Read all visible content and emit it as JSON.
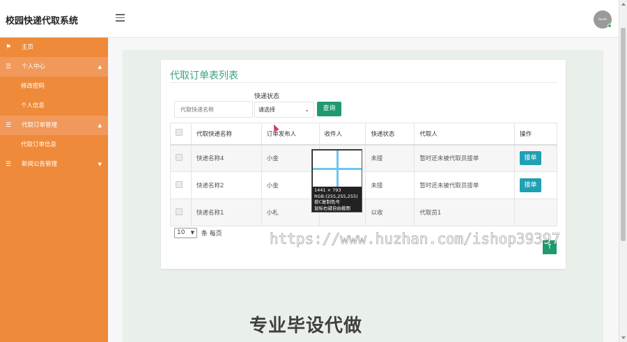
{
  "app": {
    "title": "校园快递代取系统",
    "avatar_text": "Goods",
    "accent_color": "#ee8a3a",
    "primary_color": "#1e9a6e"
  },
  "sidebar": {
    "items": [
      {
        "label": "主页",
        "icon": "flag-icon",
        "type": "plain"
      },
      {
        "label": "个人中心",
        "icon": "menu-icon",
        "type": "group",
        "caret": "▲"
      },
      {
        "label": "修改密码",
        "type": "sub"
      },
      {
        "label": "个人信息",
        "type": "sub"
      },
      {
        "label": "代取订单管理",
        "icon": "menu-icon",
        "type": "group",
        "caret": "▲"
      },
      {
        "label": "代取订单信息",
        "type": "sub"
      },
      {
        "label": "新闻公告管理",
        "icon": "menu-icon",
        "type": "plain",
        "caret": "▼"
      }
    ]
  },
  "main": {
    "card_title": "代取订单表列表",
    "search": {
      "placeholder": "代取快递名称",
      "status_label": "快递状态",
      "status_selected": "请选择",
      "query_label": "查询"
    },
    "table": {
      "headers": [
        "",
        "代取快递名称",
        "订单发布人",
        "收件人",
        "快递状态",
        "代取人",
        "操作"
      ],
      "rows": [
        {
          "name": "快递名称4",
          "publisher": "小金",
          "recipient": "",
          "status": "未接",
          "courier": "暂时还未被代取员接单",
          "action": "接单"
        },
        {
          "name": "快递名称2",
          "publisher": "小金",
          "recipient": "",
          "status": "未接",
          "courier": "暂时还未被代取员接单",
          "action": "接单"
        },
        {
          "name": "快递名称1",
          "publisher": "小札",
          "recipient": "",
          "status": "以收",
          "courier": "代取员1",
          "action": ""
        }
      ]
    },
    "pager": {
      "page_size": "10",
      "per_page_label": "条 每页"
    }
  },
  "color_picker": {
    "size": "1441 × 793",
    "rgb": "RGB:(255,255,255)",
    "copy_hint": "按C复制色号",
    "exit_hint": "鼠标右键自由截图"
  },
  "watermarks": {
    "url": "https://www.huzhan.com/ishop39397",
    "promo": "专业毕设代做"
  }
}
